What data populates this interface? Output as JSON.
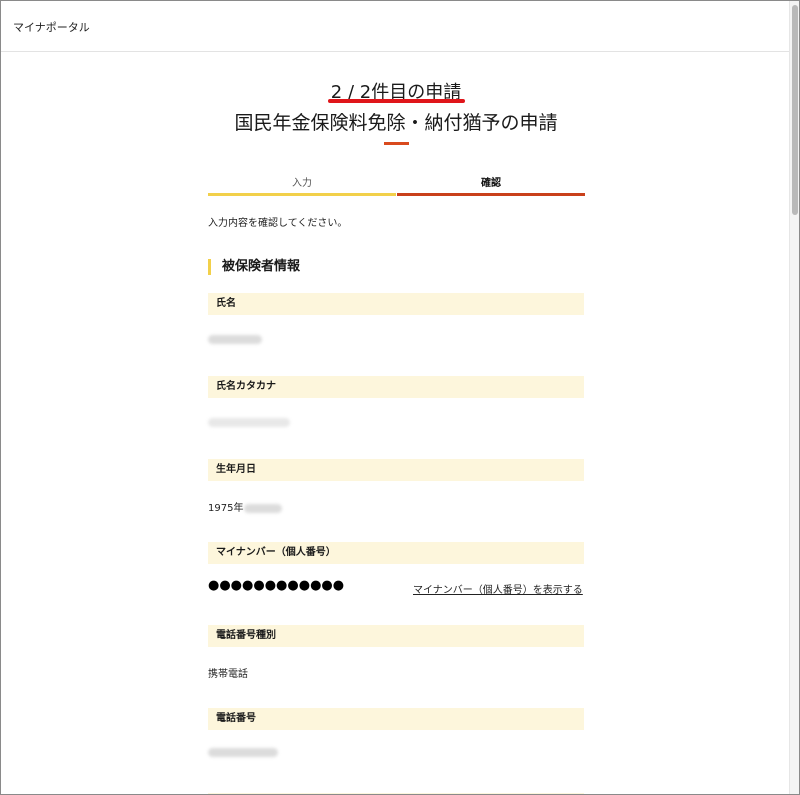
{
  "app": {
    "title": "マイナポータル"
  },
  "page": {
    "counter": "2 / 2件目の申請",
    "title": "国民年金保険料免除・納付猶予の申請",
    "instruction": "入力内容を確認してください。"
  },
  "steps": [
    {
      "label": "入力",
      "state": "done"
    },
    {
      "label": "確認",
      "state": "current"
    }
  ],
  "section": {
    "heading": "被保険者情報"
  },
  "fields": {
    "name": {
      "label": "氏名",
      "value_redacted": true
    },
    "name_kana": {
      "label": "氏名カタカナ",
      "value_redacted": true
    },
    "birthdate": {
      "label": "生年月日",
      "value": "1975年",
      "value_rest_redacted": true
    },
    "my_number": {
      "label": "マイナンバー（個人番号）",
      "masked_value": "●●●●●●●●●●●●",
      "show_link": "マイナンバー（個人番号）を表示する"
    },
    "phone_type": {
      "label": "電話番号種別",
      "value": "携帯電話"
    },
    "phone": {
      "label": "電話番号",
      "value_redacted": true
    }
  },
  "colors": {
    "accent_red": "#e0151a",
    "step_done": "#f2d04a",
    "step_current": "#c9401b",
    "label_bg": "#fdf6dc"
  }
}
